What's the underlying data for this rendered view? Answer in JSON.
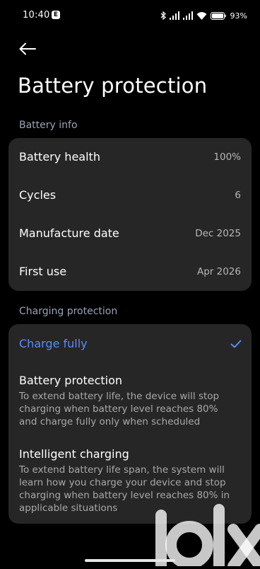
{
  "status_bar": {
    "time": "10:40",
    "notification_badge": "E",
    "battery_percent": "93%"
  },
  "page": {
    "title": "Battery protection"
  },
  "battery_info": {
    "header": "Battery info",
    "rows": [
      {
        "label": "Battery health",
        "value": "100%"
      },
      {
        "label": "Cycles",
        "value": "6"
      },
      {
        "label": "Manufacture date",
        "value": "Dec 2025"
      },
      {
        "label": "First use",
        "value": "Apr 2026"
      }
    ]
  },
  "charging_protection": {
    "header": "Charging protection",
    "options": [
      {
        "title": "Charge fully",
        "selected": true
      },
      {
        "title": "Battery protection",
        "description": "To extend battery life, the device will stop charging when battery level reaches 80% and charge fully only when scheduled"
      },
      {
        "title": "Intelligent charging",
        "description": "To extend battery life span, the system will learn how you charge your device and stop charging when battery level reaches 80% in applicable situations"
      }
    ]
  },
  "colors": {
    "accent": "#5c8cf6",
    "card": "#262626",
    "background": "#000000"
  },
  "icons": [
    "bluetooth-icon",
    "signal-icon",
    "wifi-icon",
    "battery-icon",
    "back-arrow-icon",
    "check-icon"
  ]
}
